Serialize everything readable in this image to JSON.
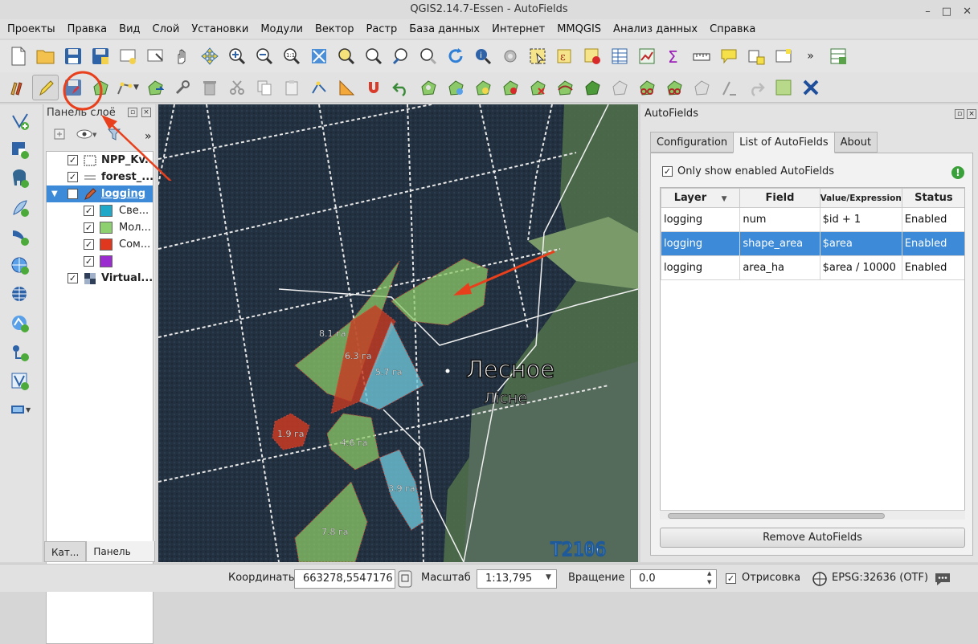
{
  "window": {
    "title": "QGIS2.14.7-Essen - AutoFields",
    "minimize": "–",
    "maximize": "□",
    "close": "✕"
  },
  "menu": [
    "Проекты",
    "Правка",
    "Вид",
    "Слой",
    "Установки",
    "Модули",
    "Вектор",
    "Растр",
    "База данных",
    "Интернет",
    "MMQGIS",
    "Анализ данных",
    "Справка"
  ],
  "layers_panel": {
    "title": "Панель слоё",
    "more": "»",
    "layers": [
      {
        "name": "NPP_Kv..."
      },
      {
        "name": "forest_..."
      },
      {
        "name": "logging"
      },
      {
        "name": "Све..."
      },
      {
        "name": "Мол..."
      },
      {
        "name": "Сом..."
      },
      {
        "name": ""
      },
      {
        "name": "Virtual..."
      }
    ],
    "tabs": [
      "Кат...",
      "Панель с..."
    ]
  },
  "map": {
    "parcels": [
      "8.1 га",
      "6.3 га",
      "5.7 га",
      "1.9 га",
      "4.6 га",
      "3.9 га",
      "7.8 га"
    ],
    "place_name": "Лесное",
    "place_name_alt": "Лісне",
    "sheet_label": "T2106"
  },
  "autofields": {
    "title": "AutoFields",
    "tabs": [
      "Configuration",
      "List of AutoFields",
      "About"
    ],
    "only_enabled_label": "Only show enabled AutoFields",
    "columns": [
      "Layer",
      "Field",
      "Value/Expression",
      "Status"
    ],
    "rows": [
      {
        "layer": "logging",
        "field": "num",
        "expr": "$id + 1",
        "status": "Enabled"
      },
      {
        "layer": "logging",
        "field": "shape_area",
        "expr": "$area",
        "status": "Enabled"
      },
      {
        "layer": "logging",
        "field": "area_ha",
        "expr": "$area  / 10000",
        "status": "Enabled"
      }
    ],
    "remove_button": "Remove AutoFields"
  },
  "status": {
    "coords_label": "Координаты",
    "coords_value": "663278,5547176",
    "scale_label": "Масштаб",
    "scale_value": "1:13,795",
    "rotation_label": "Вращение",
    "rotation_value": "0.0",
    "render_label": "Отрисовка",
    "crs": "EPSG:32636 (OTF)"
  },
  "colors": {
    "selection": "#3c8ad8",
    "annotation": "#e8401c",
    "light_blue": "#6cc3d6",
    "light_green": "#8cc968",
    "red": "#c8341e",
    "purple": "#8a2cc6"
  }
}
